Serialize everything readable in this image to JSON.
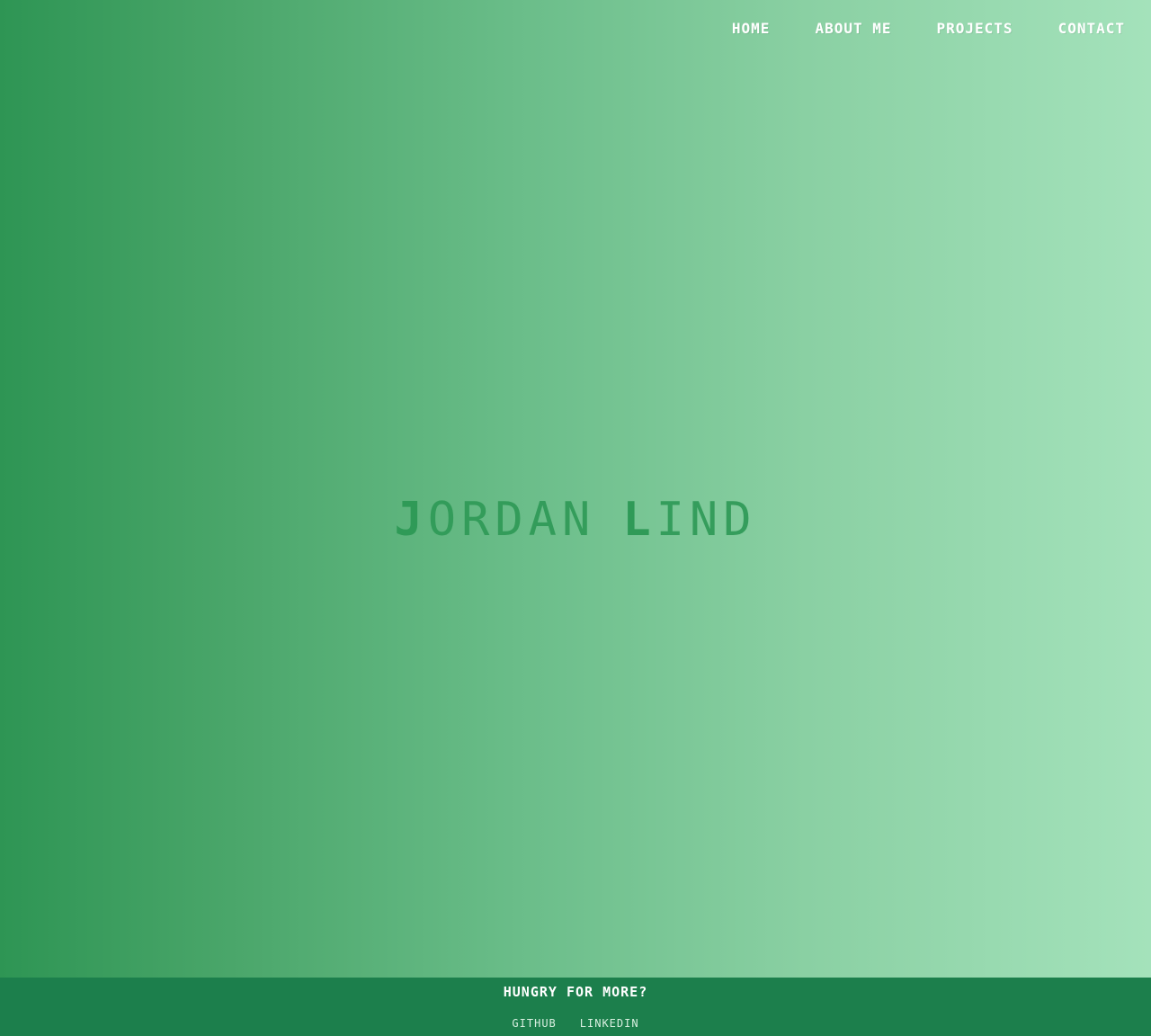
{
  "nav": {
    "items": [
      {
        "label": "HOME"
      },
      {
        "label": "ABOUT ME"
      },
      {
        "label": "PROJECTS"
      },
      {
        "label": "CONTACT"
      }
    ]
  },
  "hero": {
    "first_initial": "J",
    "first_rest": "ORDAN",
    "last_initial": "L",
    "last_rest": "IND"
  },
  "footer": {
    "heading": "HUNGRY FOR MORE?",
    "links": [
      {
        "label": "GITHUB"
      },
      {
        "label": "LINKEDIN"
      }
    ]
  },
  "colors": {
    "gradient_start": "#2e9554",
    "gradient_end": "#a4e2bb",
    "title": "#2f9a57",
    "footer_bg": "#1c7f4c",
    "nav_text": "#ffffff"
  }
}
